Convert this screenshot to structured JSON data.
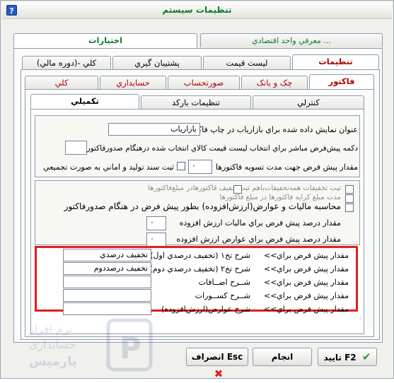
{
  "window": {
    "title": "تنظيمات سيستم",
    "help_glyph": "?"
  },
  "top_tabs": [
    {
      "label": "اختيارات"
    },
    {
      "label": "معرفي واحد اقتصادي ..."
    }
  ],
  "second_tabs": [
    {
      "label": "تنظيمات"
    },
    {
      "label": "ليست قيمت"
    },
    {
      "label": "پشتيبان گيري"
    },
    {
      "label": "کلي -(دوره مالي)"
    }
  ],
  "third_tabs": [
    {
      "label": "فاکتور"
    },
    {
      "label": "چک و بانک"
    },
    {
      "label": "صورتحساب"
    },
    {
      "label": "حسابداري"
    },
    {
      "label": "کلي"
    }
  ],
  "fourth_tabs": [
    {
      "label": "کنترلي"
    },
    {
      "label": "تنظيمات بارکد"
    },
    {
      "label": "تکميلي"
    }
  ],
  "section1": {
    "discount_label_title": "عنوان نمايش داده شده براي بازارياب در چاپ فاکتور",
    "discount_label_value": "بازارياب",
    "default_key_label": "دکمه پيش‌فرض مباشر براي انتخاب ليست قيمت کالاي انتخاب شده درهنگام صدورفاکتور",
    "default_key_value": "",
    "settlement_label": "مقدار پيش فرض جهت مدت تسويه فاکتورها",
    "settlement_value": "۰",
    "production_check": "ثبت سند توليد و اماني به صورت تجميعي"
  },
  "section2": {
    "faint1": "ثبت تخفيفات همه‌تخفيفات‌باهم       ثبت‌تخفيف فاکتورهادر مبلغ‌فاکتورها",
    "faint2": "مدت مبلغ کرايه فاکتورها در مبلغ فاکتورها",
    "tax_check": "محاسبه ماليات و عوارض(ارزش‌افزوده) بطور پيش فرض در هنگام صدورفاکتور",
    "vat_percent_label": "مقدار درصد پيش فرض براي ماليات ارزش افزوده",
    "vat_percent_value": "۰",
    "duty_percent_label": "مقدار درصد پيش فرض براي عوارض ارزش افزوده",
    "duty_percent_value": "۰"
  },
  "defaults_rows": [
    {
      "label": "مقدار پيش فرض براي",
      "arrow": "<<",
      "desc": "شرح تخ۱ (تخفيف درصدي اول)",
      "value": "تخفيف درصدي"
    },
    {
      "label": "مقدار پيش فرض براي",
      "arrow": "<<",
      "desc": "شرح تخ۲ (تخفيف درصدي دوم)",
      "value": "تخفيف درصددوم"
    },
    {
      "label": "مقدار پيش فرض براي",
      "arrow": "<<",
      "desc": "شــرح اضــافات",
      "value": ""
    },
    {
      "label": "مقدار پيش فرض براي",
      "arrow": "<<",
      "desc": "شــرح کســورات",
      "value": ""
    },
    {
      "label": "مقدار پيش فرض براي",
      "arrow": "<<",
      "desc": "شرح عوارض(ارزش‌افزوده)",
      "value": ""
    }
  ],
  "buttons": {
    "confirm": "تاييد F2",
    "apply": "انجام",
    "cancel": "انصراف Esc"
  },
  "watermark": {
    "line1": "نرم افزار",
    "line2": "حسابداری",
    "line3": "پارمیس"
  },
  "colors": {
    "title": "#0a7a2a",
    "highlight": "#e11f1f",
    "active_tab_text": "#b00000"
  }
}
